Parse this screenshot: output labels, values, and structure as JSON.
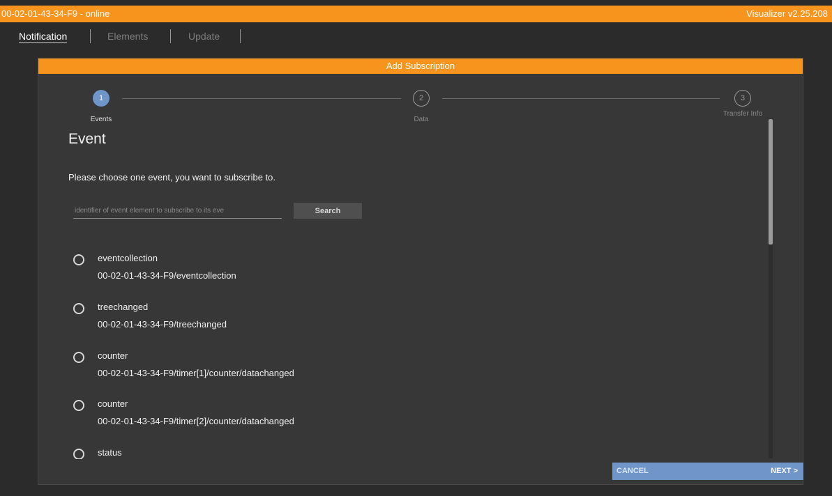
{
  "titlebar": {
    "device_status": "00-02-01-43-34-F9 - online",
    "app_version": "Visualizer v2.25.208"
  },
  "tabs": [
    {
      "label": "Notification",
      "active": true
    },
    {
      "label": "Elements",
      "active": false
    },
    {
      "label": "Update",
      "active": false
    }
  ],
  "dialog": {
    "title": "Add Subscription",
    "steps": [
      {
        "number": "1",
        "label": "Events",
        "active": true
      },
      {
        "number": "2",
        "label": "Data",
        "active": false
      },
      {
        "number": "3",
        "label": "Transfer Info",
        "active": false
      }
    ],
    "section_title": "Event",
    "instruction": "Please choose one event, you want to subscribe to.",
    "search": {
      "placeholder": "identifier of event element to subscribe to its eve",
      "value": "",
      "button_label": "Search"
    },
    "events": [
      {
        "name": "eventcollection",
        "path": "00-02-01-43-34-F9/eventcollection",
        "selected": false
      },
      {
        "name": "treechanged",
        "path": "00-02-01-43-34-F9/treechanged",
        "selected": false
      },
      {
        "name": "counter",
        "path": "00-02-01-43-34-F9/timer[1]/counter/datachanged",
        "selected": false
      },
      {
        "name": "counter",
        "path": "00-02-01-43-34-F9/timer[2]/counter/datachanged",
        "selected": false
      },
      {
        "name": "status",
        "path": "",
        "selected": false
      }
    ],
    "footer": {
      "cancel_label": "CANCEL",
      "next_label": "NEXT >"
    }
  },
  "colors": {
    "accent": "#f7941d",
    "primary": "#6f95c9",
    "background": "#2b2b2b",
    "panel": "#373737"
  },
  "icons": {
    "radio": "radio-unchecked-icon"
  }
}
